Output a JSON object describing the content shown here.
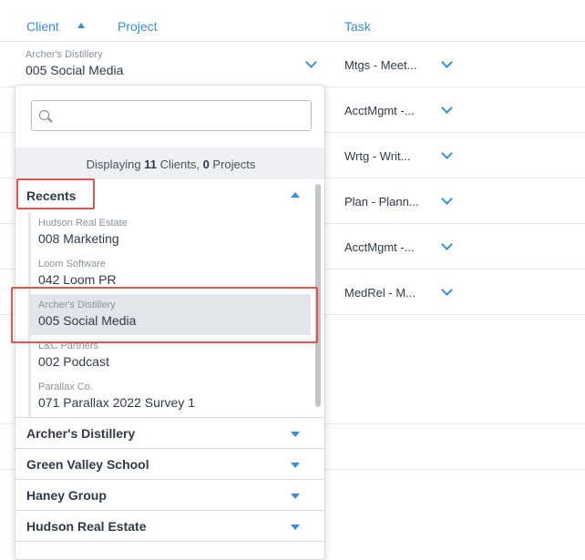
{
  "header": {
    "client_label": "Client",
    "project_label": "Project",
    "task_label": "Task"
  },
  "rows": [
    {
      "client": "Archer's Distillery",
      "project": "005 Social Media",
      "task": "Mtgs - Meet..."
    },
    {
      "client": "",
      "project": "",
      "task": "AcctMgmt -..."
    },
    {
      "client": "",
      "project": "",
      "task": "Wrtg - Writ..."
    },
    {
      "client": "",
      "project": "",
      "task": "Plan - Plann..."
    },
    {
      "client": "",
      "project": "",
      "task": "AcctMgmt -..."
    },
    {
      "client": "",
      "project": "",
      "task": "MedRel - M..."
    }
  ],
  "dropdown": {
    "search_placeholder": "",
    "display_prefix": "Displaying",
    "client_count": "11",
    "clients_word": "Clients,",
    "project_count": "0",
    "projects_word": "Projects",
    "recents_label": "Recents",
    "recents": [
      {
        "client": "Hudson Real Estate",
        "project": "008 Marketing"
      },
      {
        "client": "Loom Software",
        "project": "042 Loom PR"
      },
      {
        "client": "Archer's Distillery",
        "project": "005 Social Media"
      },
      {
        "client": "L&C Partners",
        "project": "002 Podcast"
      },
      {
        "client": "Parallax Co.",
        "project": "071 Parallax 2022 Survey 1"
      }
    ],
    "groups": [
      {
        "label": "Archer's Distillery"
      },
      {
        "label": "Green Valley School"
      },
      {
        "label": "Haney Group"
      },
      {
        "label": "Hudson Real Estate"
      }
    ]
  },
  "colors": {
    "accent": "#3a8fd8",
    "highlight": "#e2544f",
    "selected_bg": "#e2e5e9"
  }
}
